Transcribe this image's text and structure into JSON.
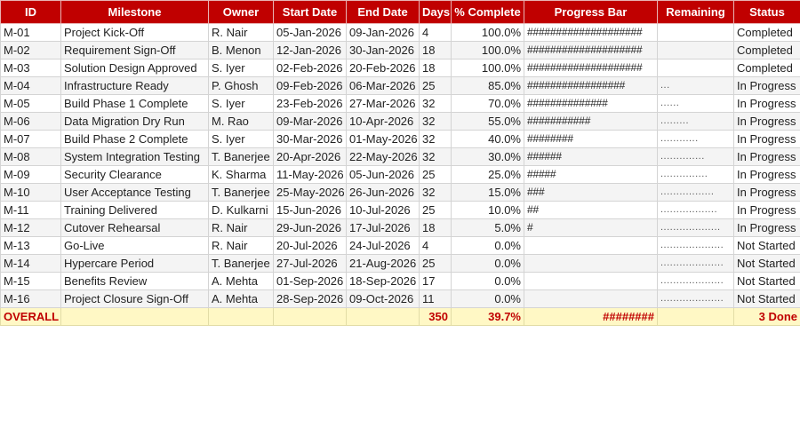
{
  "headers": [
    "ID",
    "Milestone",
    "Owner",
    "Start Date",
    "End Date",
    "Days",
    "% Complete",
    "Progress Bar",
    "Remaining",
    "Status"
  ],
  "rows": [
    {
      "id": "M-01",
      "milestone": "Project Kick-Off",
      "owner": "R. Nair",
      "start": "05-Jan-2026",
      "end": "09-Jan-2026",
      "days": "4",
      "pct": "100.0%",
      "bar": "####################",
      "remaining": "",
      "status": "Completed"
    },
    {
      "id": "M-02",
      "milestone": "Requirement Sign-Off",
      "owner": "B. Menon",
      "start": "12-Jan-2026",
      "end": "30-Jan-2026",
      "days": "18",
      "pct": "100.0%",
      "bar": "####################",
      "remaining": "",
      "status": "Completed"
    },
    {
      "id": "M-03",
      "milestone": "Solution Design Approved",
      "owner": "S. Iyer",
      "start": "02-Feb-2026",
      "end": "20-Feb-2026",
      "days": "18",
      "pct": "100.0%",
      "bar": "####################",
      "remaining": "",
      "status": "Completed"
    },
    {
      "id": "M-04",
      "milestone": "Infrastructure Ready",
      "owner": "P. Ghosh",
      "start": "09-Feb-2026",
      "end": "06-Mar-2026",
      "days": "25",
      "pct": "85.0%",
      "bar": "#################",
      "remaining": "...",
      "status": "In Progress"
    },
    {
      "id": "M-05",
      "milestone": "Build Phase 1 Complete",
      "owner": "S. Iyer",
      "start": "23-Feb-2026",
      "end": "27-Mar-2026",
      "days": "32",
      "pct": "70.0%",
      "bar": "##############",
      "remaining": "......",
      "status": "In Progress"
    },
    {
      "id": "M-06",
      "milestone": "Data Migration Dry Run",
      "owner": "M. Rao",
      "start": "09-Mar-2026",
      "end": "10-Apr-2026",
      "days": "32",
      "pct": "55.0%",
      "bar": "###########",
      "remaining": ".........",
      "status": "In Progress"
    },
    {
      "id": "M-07",
      "milestone": "Build Phase 2 Complete",
      "owner": "S. Iyer",
      "start": "30-Mar-2026",
      "end": "01-May-2026",
      "days": "32",
      "pct": "40.0%",
      "bar": "########",
      "remaining": "............",
      "status": "In Progress"
    },
    {
      "id": "M-08",
      "milestone": "System Integration Testing",
      "owner": "T. Banerjee",
      "start": "20-Apr-2026",
      "end": "22-May-2026",
      "days": "32",
      "pct": "30.0%",
      "bar": "######",
      "remaining": "..............",
      "status": "In Progress"
    },
    {
      "id": "M-09",
      "milestone": "Security Clearance",
      "owner": "K. Sharma",
      "start": "11-May-2026",
      "end": "05-Jun-2026",
      "days": "25",
      "pct": "25.0%",
      "bar": "#####",
      "remaining": "...............",
      "status": "In Progress"
    },
    {
      "id": "M-10",
      "milestone": "User Acceptance Testing",
      "owner": "T. Banerjee",
      "start": "25-May-2026",
      "end": "26-Jun-2026",
      "days": "32",
      "pct": "15.0%",
      "bar": "###",
      "remaining": ".................",
      "status": "In Progress"
    },
    {
      "id": "M-11",
      "milestone": "Training Delivered",
      "owner": "D. Kulkarni",
      "start": "15-Jun-2026",
      "end": "10-Jul-2026",
      "days": "25",
      "pct": "10.0%",
      "bar": "##",
      "remaining": "..................",
      "status": "In Progress"
    },
    {
      "id": "M-12",
      "milestone": "Cutover Rehearsal",
      "owner": "R. Nair",
      "start": "29-Jun-2026",
      "end": "17-Jul-2026",
      "days": "18",
      "pct": "5.0%",
      "bar": "#",
      "remaining": "...................",
      "status": "In Progress"
    },
    {
      "id": "M-13",
      "milestone": "Go-Live",
      "owner": "R. Nair",
      "start": "20-Jul-2026",
      "end": "24-Jul-2026",
      "days": "4",
      "pct": "0.0%",
      "bar": "",
      "remaining": "....................",
      "status": "Not Started"
    },
    {
      "id": "M-14",
      "milestone": "Hypercare Period",
      "owner": "T. Banerjee",
      "start": "27-Jul-2026",
      "end": "21-Aug-2026",
      "days": "25",
      "pct": "0.0%",
      "bar": "",
      "remaining": "....................",
      "status": "Not Started"
    },
    {
      "id": "M-15",
      "milestone": "Benefits Review",
      "owner": "A. Mehta",
      "start": "01-Sep-2026",
      "end": "18-Sep-2026",
      "days": "17",
      "pct": "0.0%",
      "bar": "",
      "remaining": "....................",
      "status": "Not Started"
    },
    {
      "id": "M-16",
      "milestone": "Project Closure Sign-Off",
      "owner": "A. Mehta",
      "start": "28-Sep-2026",
      "end": "09-Oct-2026",
      "days": "11",
      "pct": "0.0%",
      "bar": "",
      "remaining": "....................",
      "status": "Not Started"
    }
  ],
  "overall": {
    "label": "OVERALL",
    "days": "350",
    "pct": "39.7%",
    "bar": "########",
    "status": "3 Done"
  },
  "colors": {
    "header_bg": "#c00000",
    "header_text": "#ffffff",
    "total_bg": "#fff8c5",
    "total_text": "#c00000"
  }
}
